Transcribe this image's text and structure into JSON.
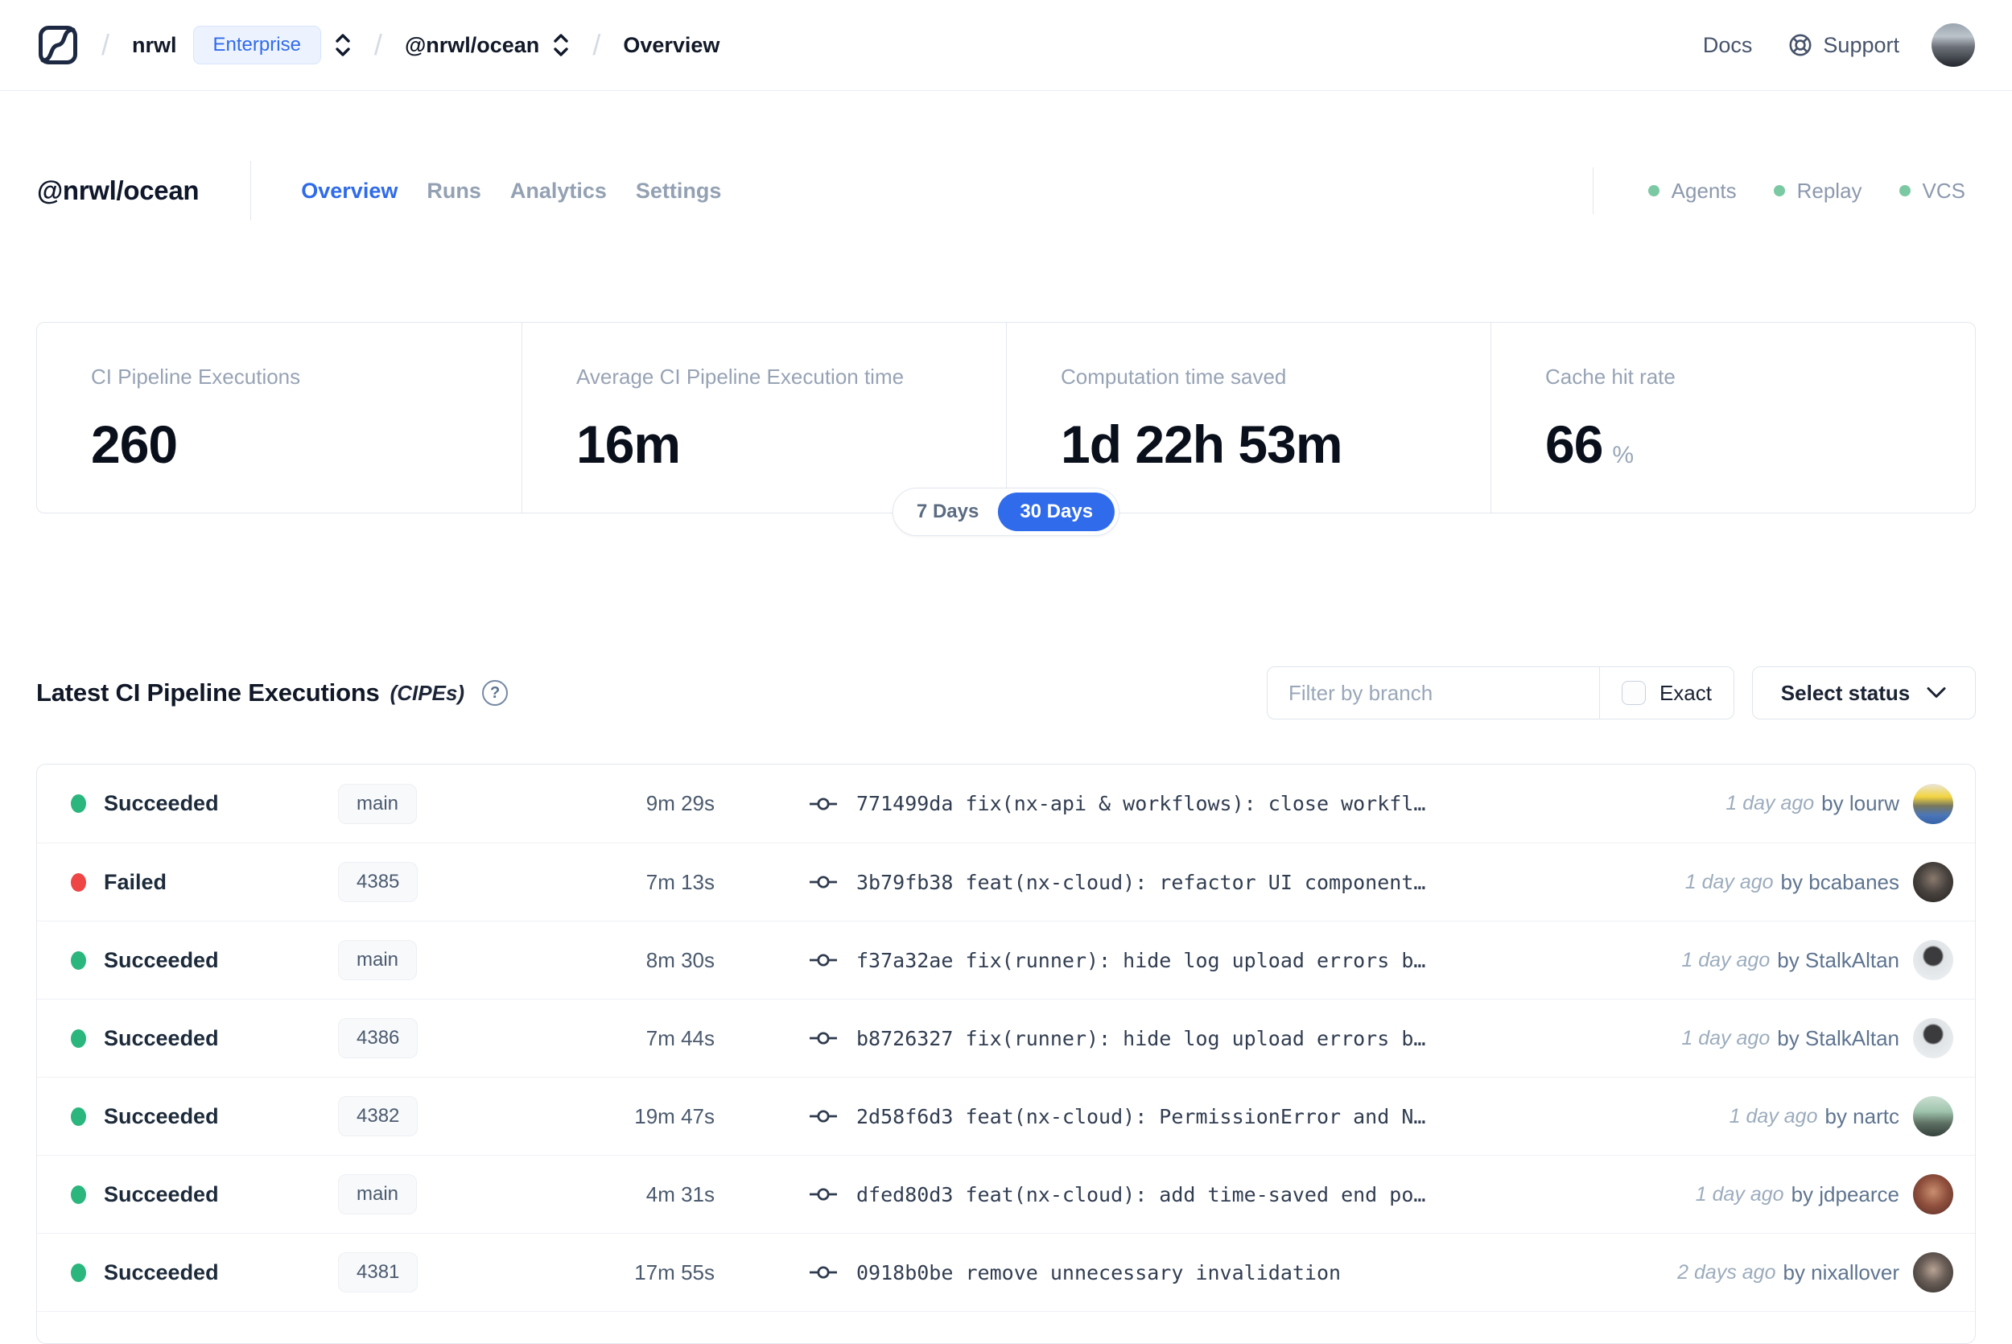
{
  "colors": {
    "accent_blue": "#2f6bea",
    "success_green": "#2ab67d",
    "failure_red": "#ee4545",
    "feature_dot_green": "#7bc9a3"
  },
  "topnav": {
    "breadcrumb": {
      "org": "nrwl",
      "org_badge": "Enterprise",
      "workspace": "@nrwl/ocean",
      "page": "Overview"
    },
    "docs_label": "Docs",
    "support_label": "Support"
  },
  "workspace_header": {
    "title": "@nrwl/ocean",
    "tabs": [
      {
        "label": "Overview",
        "active": true
      },
      {
        "label": "Runs",
        "active": false
      },
      {
        "label": "Analytics",
        "active": false
      },
      {
        "label": "Settings",
        "active": false
      }
    ],
    "features": [
      {
        "label": "Agents",
        "status": "on"
      },
      {
        "label": "Replay",
        "status": "on"
      },
      {
        "label": "VCS",
        "status": "on"
      }
    ]
  },
  "stats": [
    {
      "label": "CI Pipeline Executions",
      "value": "260"
    },
    {
      "label": "Average CI Pipeline Execution time",
      "value": "16m"
    },
    {
      "label": "Computation time saved",
      "value": "1d 22h 53m"
    },
    {
      "label": "Cache hit rate",
      "value": "66",
      "unit": "%"
    }
  ],
  "range_toggle": {
    "inactive": "7 Days",
    "active": "30 Days",
    "selected": "30 Days"
  },
  "cipes": {
    "title": "Latest CI Pipeline Executions",
    "title_suffix": "(CIPEs)",
    "filter": {
      "placeholder": "Filter by branch",
      "exact_label": "Exact",
      "exact_checked": false
    },
    "status_select_label": "Select status",
    "rows": [
      {
        "status": "Succeeded",
        "branch": "main",
        "duration": "9m 29s",
        "commit": "771499da",
        "message": "fix(nx-api & workflows): close workfl…",
        "time": "1 day ago",
        "author": "by lourw"
      },
      {
        "status": "Failed",
        "branch": "4385",
        "duration": "7m 13s",
        "commit": "3b79fb38",
        "message": "feat(nx-cloud): refactor UI component…",
        "time": "1 day ago",
        "author": "by bcabanes"
      },
      {
        "status": "Succeeded",
        "branch": "main",
        "duration": "8m 30s",
        "commit": "f37a32ae",
        "message": "fix(runner): hide log upload errors b…",
        "time": "1 day ago",
        "author": "by StalkAltan"
      },
      {
        "status": "Succeeded",
        "branch": "4386",
        "duration": "7m 44s",
        "commit": "b8726327",
        "message": "fix(runner): hide log upload errors b…",
        "time": "1 day ago",
        "author": "by StalkAltan"
      },
      {
        "status": "Succeeded",
        "branch": "4382",
        "duration": "19m 47s",
        "commit": "2d58f6d3",
        "message": "feat(nx-cloud): PermissionError and N…",
        "time": "1 day ago",
        "author": "by nartc"
      },
      {
        "status": "Succeeded",
        "branch": "main",
        "duration": "4m 31s",
        "commit": "dfed80d3",
        "message": "feat(nx-cloud): add time-saved end po…",
        "time": "1 day ago",
        "author": "by jdpearce"
      },
      {
        "status": "Succeeded",
        "branch": "4381",
        "duration": "17m 55s",
        "commit": "0918b0be",
        "message": "remove unnecessary invalidation",
        "time": "2 days ago",
        "author": "by nixallover"
      }
    ]
  }
}
